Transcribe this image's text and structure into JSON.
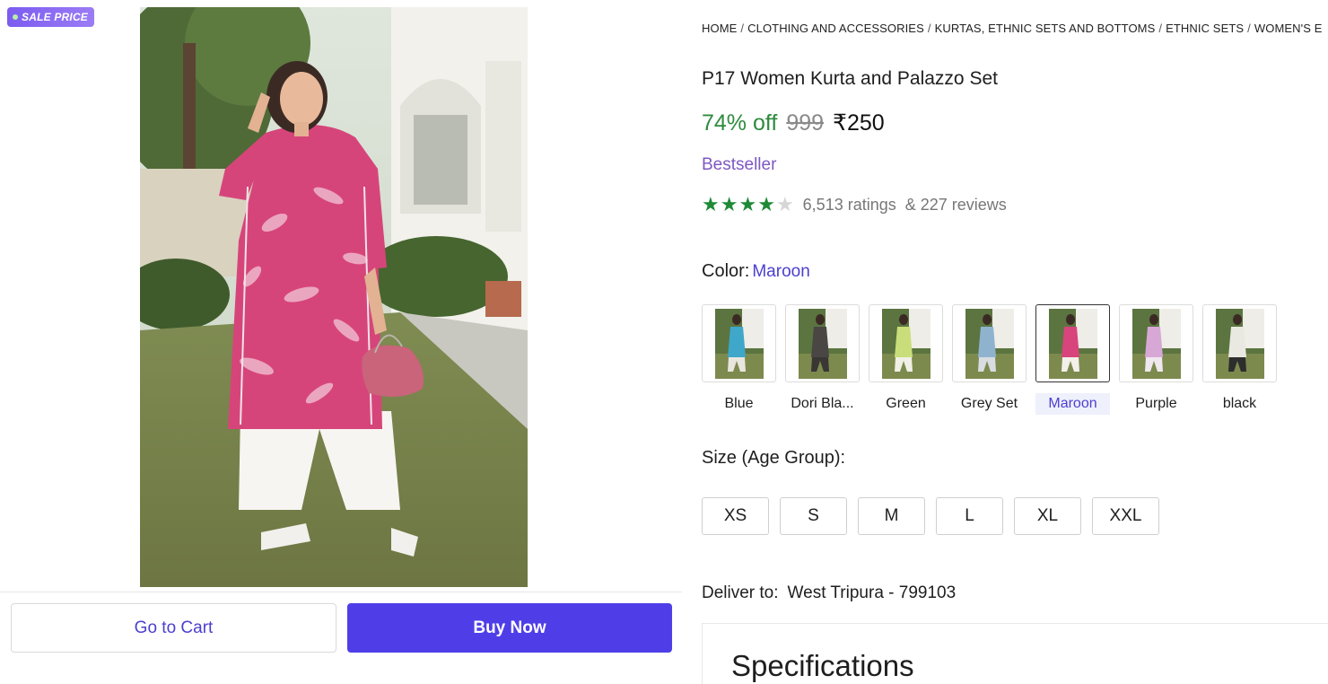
{
  "badge": {
    "text": "SALE PRICE"
  },
  "actions": {
    "go_to_cart": "Go to Cart",
    "buy_now": "Buy Now"
  },
  "breadcrumb": [
    "HOME",
    "CLOTHING AND ACCESSORIES",
    "KURTAS, ETHNIC SETS AND BOTTOMS",
    "ETHNIC SETS",
    "WOMEN'S E"
  ],
  "product": {
    "title": "P17 Women Kurta and Palazzo Set",
    "discount": "74% off",
    "mrp": "999",
    "price": "₹250",
    "tag": "Bestseller",
    "rating_stars": 4,
    "rating_max": 5,
    "ratings": "6,513 ratings",
    "reviews": "& 227 reviews"
  },
  "color": {
    "label": "Color:",
    "selected": "Maroon",
    "options": [
      {
        "name": "Blue",
        "top": "#3fa7c9",
        "bottom": "#e9e6df"
      },
      {
        "name": "Dori Bla...",
        "top": "#4a4644",
        "bottom": "#3a3634"
      },
      {
        "name": "Green",
        "top": "#c9dd7a",
        "bottom": "#f0f0e6"
      },
      {
        "name": "Grey Set",
        "top": "#8fb3cf",
        "bottom": "#d8dde2"
      },
      {
        "name": "Maroon",
        "top": "#d8457c",
        "bottom": "#f3f0ea"
      },
      {
        "name": "Purple",
        "top": "#d7a7d6",
        "bottom": "#efe8ef"
      },
      {
        "name": "black",
        "top": "#e9e9e2",
        "bottom": "#2d2d2d"
      }
    ]
  },
  "size": {
    "label": "Size (Age Group):",
    "options": [
      "XS",
      "S",
      "M",
      "L",
      "XL",
      "XXL"
    ]
  },
  "delivery": {
    "label": "Deliver to:",
    "location": "West Tripura - 799103"
  },
  "specs": {
    "title": "Specifications"
  },
  "colors": {
    "accent": "#4f3ee8",
    "discount": "#2e8b3e",
    "bestseller": "#7e57c2",
    "star": "#1f8a36"
  }
}
